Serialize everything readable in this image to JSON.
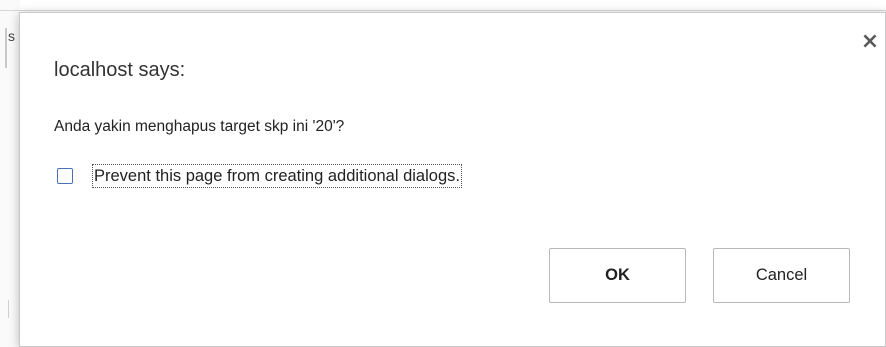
{
  "background": {
    "edge_char": "s"
  },
  "dialog": {
    "title": "localhost says:",
    "close_glyph": "×",
    "message": "Anda yakin menghapus target skp ini '20'?",
    "checkbox": {
      "label": "Prevent this page from creating additional dialogs.",
      "checked": false
    },
    "buttons": {
      "ok": "OK",
      "cancel": "Cancel"
    }
  },
  "colors": {
    "checkbox_border": "#4a6fb8",
    "button_border": "#b8b8b8",
    "text": "#222222"
  }
}
